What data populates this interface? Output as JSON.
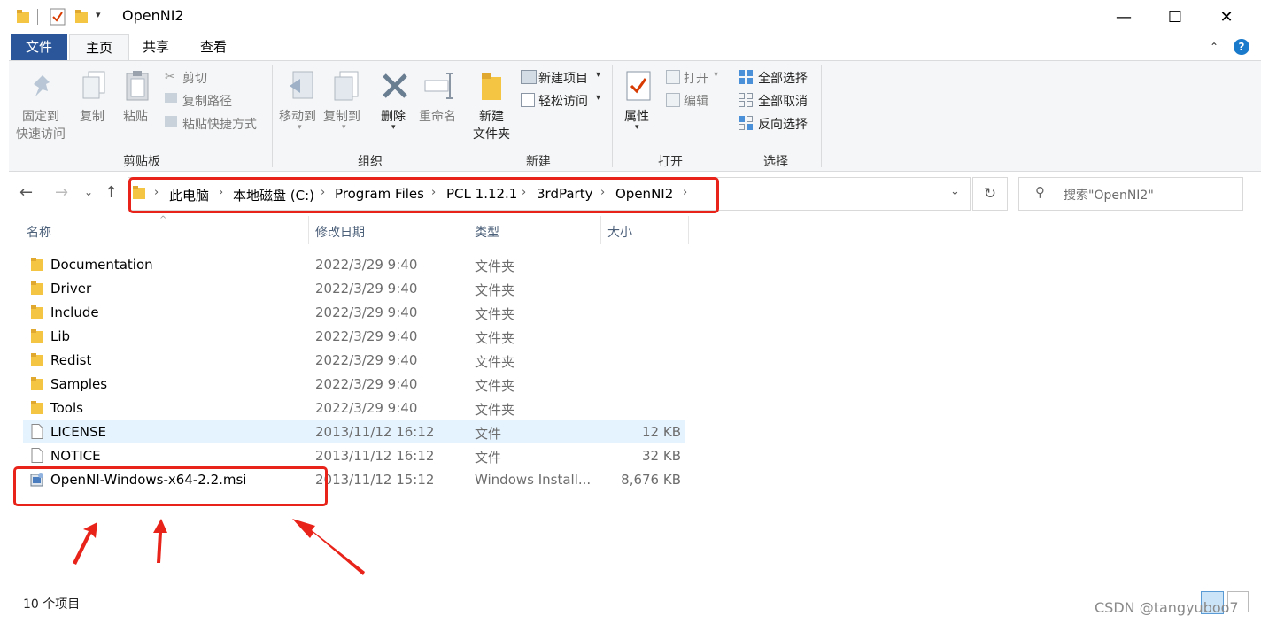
{
  "window": {
    "title": "OpenNI2",
    "minimize": "—",
    "maximize": "☐",
    "close": "✕"
  },
  "tabs": [
    {
      "label": "文件"
    },
    {
      "label": "主页"
    },
    {
      "label": "共享"
    },
    {
      "label": "查看"
    }
  ],
  "ribbon": {
    "clipboard": {
      "group": "剪贴板",
      "pin_line1": "固定到",
      "pin_line2": "快速访问",
      "copy": "复制",
      "paste": "粘贴",
      "cut": "剪切",
      "copy_path": "复制路径",
      "paste_shortcut": "粘贴快捷方式"
    },
    "organize": {
      "group": "组织",
      "move_to": "移动到",
      "copy_to": "复制到",
      "delete": "删除",
      "rename": "重命名"
    },
    "new": {
      "group": "新建",
      "new_folder_line1": "新建",
      "new_folder_line2": "文件夹",
      "new_item": "新建项目",
      "easy_access": "轻松访问"
    },
    "open": {
      "group": "打开",
      "properties": "属性",
      "open": "打开",
      "edit": "编辑"
    },
    "select": {
      "group": "选择",
      "select_all": "全部选择",
      "select_none": "全部取消",
      "invert": "反向选择"
    }
  },
  "address": {
    "crumbs": [
      "此电脑",
      "本地磁盘 (C:)",
      "Program Files",
      "PCL 1.12.1",
      "3rdParty",
      "OpenNI2"
    ],
    "search_placeholder": "搜索\"OpenNI2\""
  },
  "columns": {
    "name": "名称",
    "date": "修改日期",
    "type": "类型",
    "size": "大小"
  },
  "files": [
    {
      "name": "Documentation",
      "date": "2022/3/29 9:40",
      "type": "文件夹",
      "size": "",
      "icon": "folder-icon"
    },
    {
      "name": "Driver",
      "date": "2022/3/29 9:40",
      "type": "文件夹",
      "size": "",
      "icon": "folder-icon"
    },
    {
      "name": "Include",
      "date": "2022/3/29 9:40",
      "type": "文件夹",
      "size": "",
      "icon": "folder-icon"
    },
    {
      "name": "Lib",
      "date": "2022/3/29 9:40",
      "type": "文件夹",
      "size": "",
      "icon": "folder-icon"
    },
    {
      "name": "Redist",
      "date": "2022/3/29 9:40",
      "type": "文件夹",
      "size": "",
      "icon": "folder-icon"
    },
    {
      "name": "Samples",
      "date": "2022/3/29 9:40",
      "type": "文件夹",
      "size": "",
      "icon": "folder-icon"
    },
    {
      "name": "Tools",
      "date": "2022/3/29 9:40",
      "type": "文件夹",
      "size": "",
      "icon": "folder-icon"
    },
    {
      "name": "LICENSE",
      "date": "2013/11/12 16:12",
      "type": "文件",
      "size": "12 KB",
      "icon": "file-icon"
    },
    {
      "name": "NOTICE",
      "date": "2013/11/12 16:12",
      "type": "文件",
      "size": "32 KB",
      "icon": "file-icon"
    },
    {
      "name": "OpenNI-Windows-x64-2.2.msi",
      "date": "2013/11/12 15:12",
      "type": "Windows Install...",
      "size": "8,676 KB",
      "icon": "installer-icon"
    }
  ],
  "status": {
    "count": "10 个项目"
  },
  "watermark": "CSDN @tangyuboo7",
  "colors": {
    "accent": "#2b579a",
    "annotation_red": "#e8241a",
    "folder_yellow": "#f4c542",
    "hover_row": "#e5f3ff"
  }
}
